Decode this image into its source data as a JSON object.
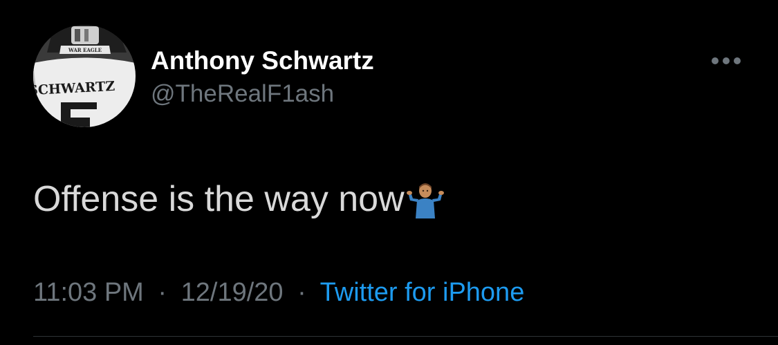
{
  "tweet": {
    "author": {
      "display_name": "Anthony Schwartz",
      "handle": "@TheRealF1ash",
      "avatar_jersey_name": "SCHWARTZ",
      "avatar_helmet_text": "WAR EAGLE"
    },
    "text": "Offense is the way now",
    "emoji": "man-shrugging",
    "time": "11:03 PM",
    "separator": "·",
    "date": "12/19/20",
    "source": "Twitter for iPhone"
  },
  "colors": {
    "background": "#000000",
    "primary_text": "#ffffff",
    "secondary_text": "#6e767d",
    "link": "#1d9bf0"
  },
  "icons": {
    "more": "more-horizontal-icon"
  }
}
